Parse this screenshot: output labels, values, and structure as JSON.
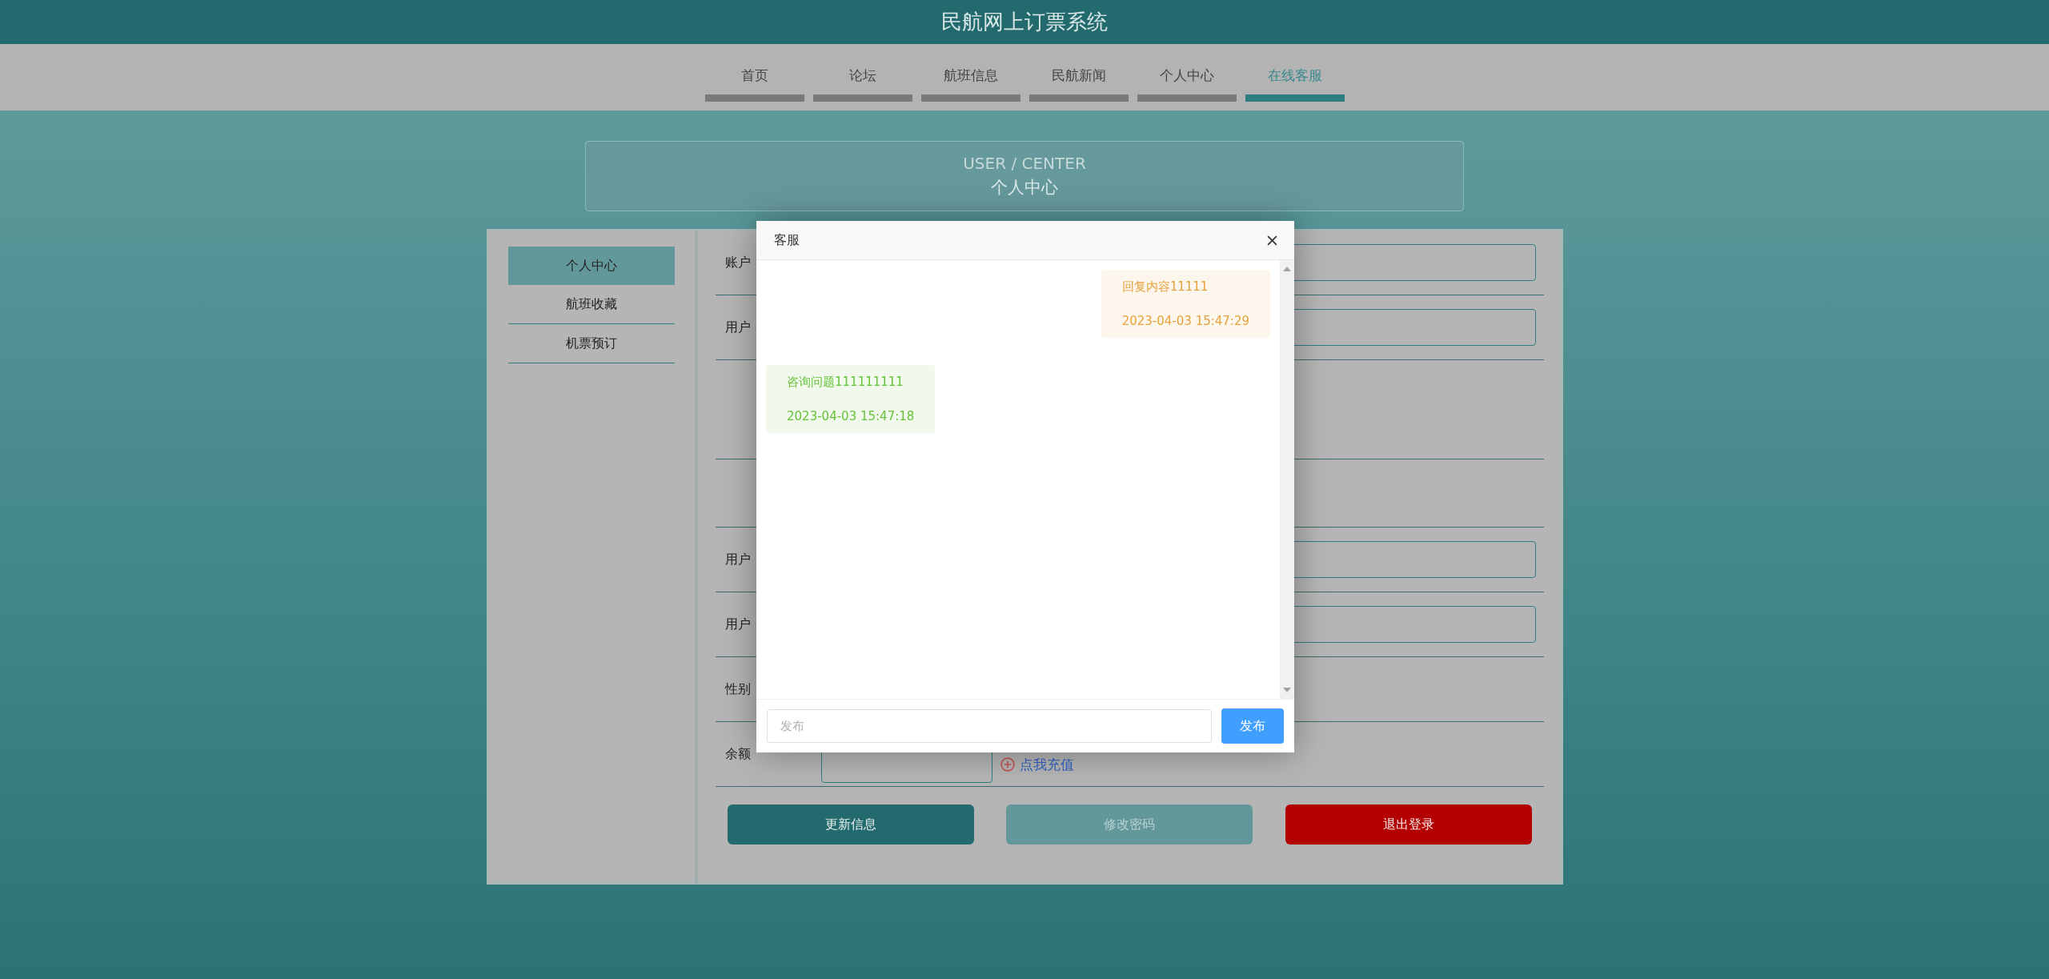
{
  "header": {
    "title": "民航网上订票系统"
  },
  "nav": [
    {
      "label": "首页",
      "selected": false
    },
    {
      "label": "论坛",
      "selected": false
    },
    {
      "label": "航班信息",
      "selected": false
    },
    {
      "label": "民航新闻",
      "selected": false
    },
    {
      "label": "个人中心",
      "selected": false
    },
    {
      "label": "在线客服",
      "selected": true
    }
  ],
  "banner": {
    "title_en": "USER / CENTER",
    "title": "个人中心"
  },
  "sidebar": [
    {
      "label": "个人中心",
      "selected": true
    },
    {
      "label": "航班收藏",
      "selected": false
    },
    {
      "label": "机票预订",
      "selected": false
    }
  ],
  "form": {
    "rows": [
      {
        "kind": "input",
        "label": "账户"
      },
      {
        "kind": "input",
        "label": "用户"
      },
      {
        "kind": "blank"
      },
      {
        "kind": "blank"
      },
      {
        "kind": "input",
        "label": "用户"
      },
      {
        "kind": "input",
        "label": "用户"
      },
      {
        "kind": "plain",
        "label": "性别"
      },
      {
        "kind": "balance",
        "label": "余额",
        "link": "点我充值"
      }
    ]
  },
  "actions": [
    {
      "label": "更新信息",
      "kind": "primary"
    },
    {
      "label": "修改密码",
      "kind": "secondary"
    },
    {
      "label": "退出登录",
      "kind": "danger"
    }
  ],
  "dialog": {
    "title": "客服",
    "messages": [
      {
        "kind": "outgoing",
        "text": "回复内容11111",
        "time": "2023-04-03 15:47:29"
      },
      {
        "kind": "incoming",
        "text": "咨询问题111111111",
        "time": "2023-04-03 15:47:18"
      }
    ],
    "input": {
      "placeholder": "发布"
    },
    "send_button": "发布"
  }
}
